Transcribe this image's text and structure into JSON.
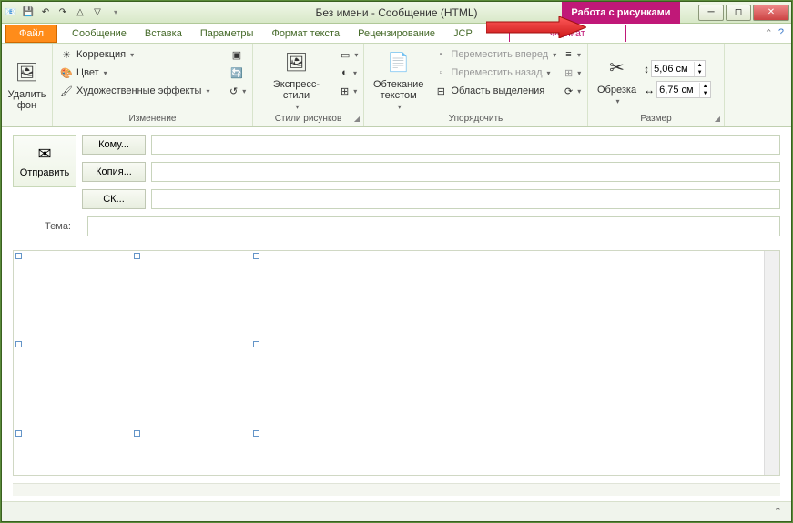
{
  "title": "Без имени  -  Сообщение (HTML)",
  "context_group": "Работа с рисунками",
  "tabs": {
    "file": "Файл",
    "message": "Сообщение",
    "insert": "Вставка",
    "options": "Параметры",
    "format_text": "Формат текста",
    "review": "Рецензирование",
    "jcp": "JCP",
    "format": "Формат"
  },
  "ribbon": {
    "remove_bg": "Удалить\nфон",
    "correction": "Коррекция",
    "color": "Цвет",
    "artistic": "Художественные эффекты",
    "group_adjust": "Изменение",
    "express_styles": "Экспресс-стили",
    "group_styles": "Стили рисунков",
    "wrap_text": "Обтекание\nтекстом",
    "bring_forward": "Переместить вперед",
    "send_backward": "Переместить назад",
    "selection_pane": "Область выделения",
    "group_arrange": "Упорядочить",
    "crop": "Обрезка",
    "height_val": "5,06 см",
    "width_val": "6,75 см",
    "group_size": "Размер"
  },
  "compose": {
    "send": "Отправить",
    "to": "Кому...",
    "cc": "Копия...",
    "bcc": "СК...",
    "subject": "Тема:"
  },
  "icons": {
    "correction": "☀",
    "color": "🎨",
    "artistic": "🖌",
    "remove_bg": "🖼",
    "express": "🖼",
    "wrap": "📄",
    "crop": "✂",
    "height": "↕",
    "width": "↔",
    "envelope": "✉"
  }
}
